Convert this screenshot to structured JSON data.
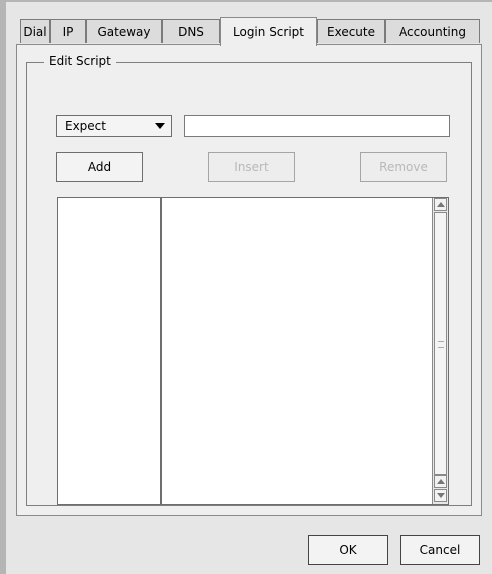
{
  "tabs": [
    {
      "label": "Dial"
    },
    {
      "label": "IP"
    },
    {
      "label": "Gateway"
    },
    {
      "label": "DNS"
    },
    {
      "label": "Login Script"
    },
    {
      "label": "Execute"
    },
    {
      "label": "Accounting"
    }
  ],
  "active_tab": "Login Script",
  "group": {
    "label": "Edit Script"
  },
  "controls": {
    "combo_value": "Expect",
    "text_value": "",
    "add_label": "Add",
    "insert_label": "Insert",
    "remove_label": "Remove"
  },
  "dialog": {
    "ok_label": "OK",
    "cancel_label": "Cancel"
  }
}
